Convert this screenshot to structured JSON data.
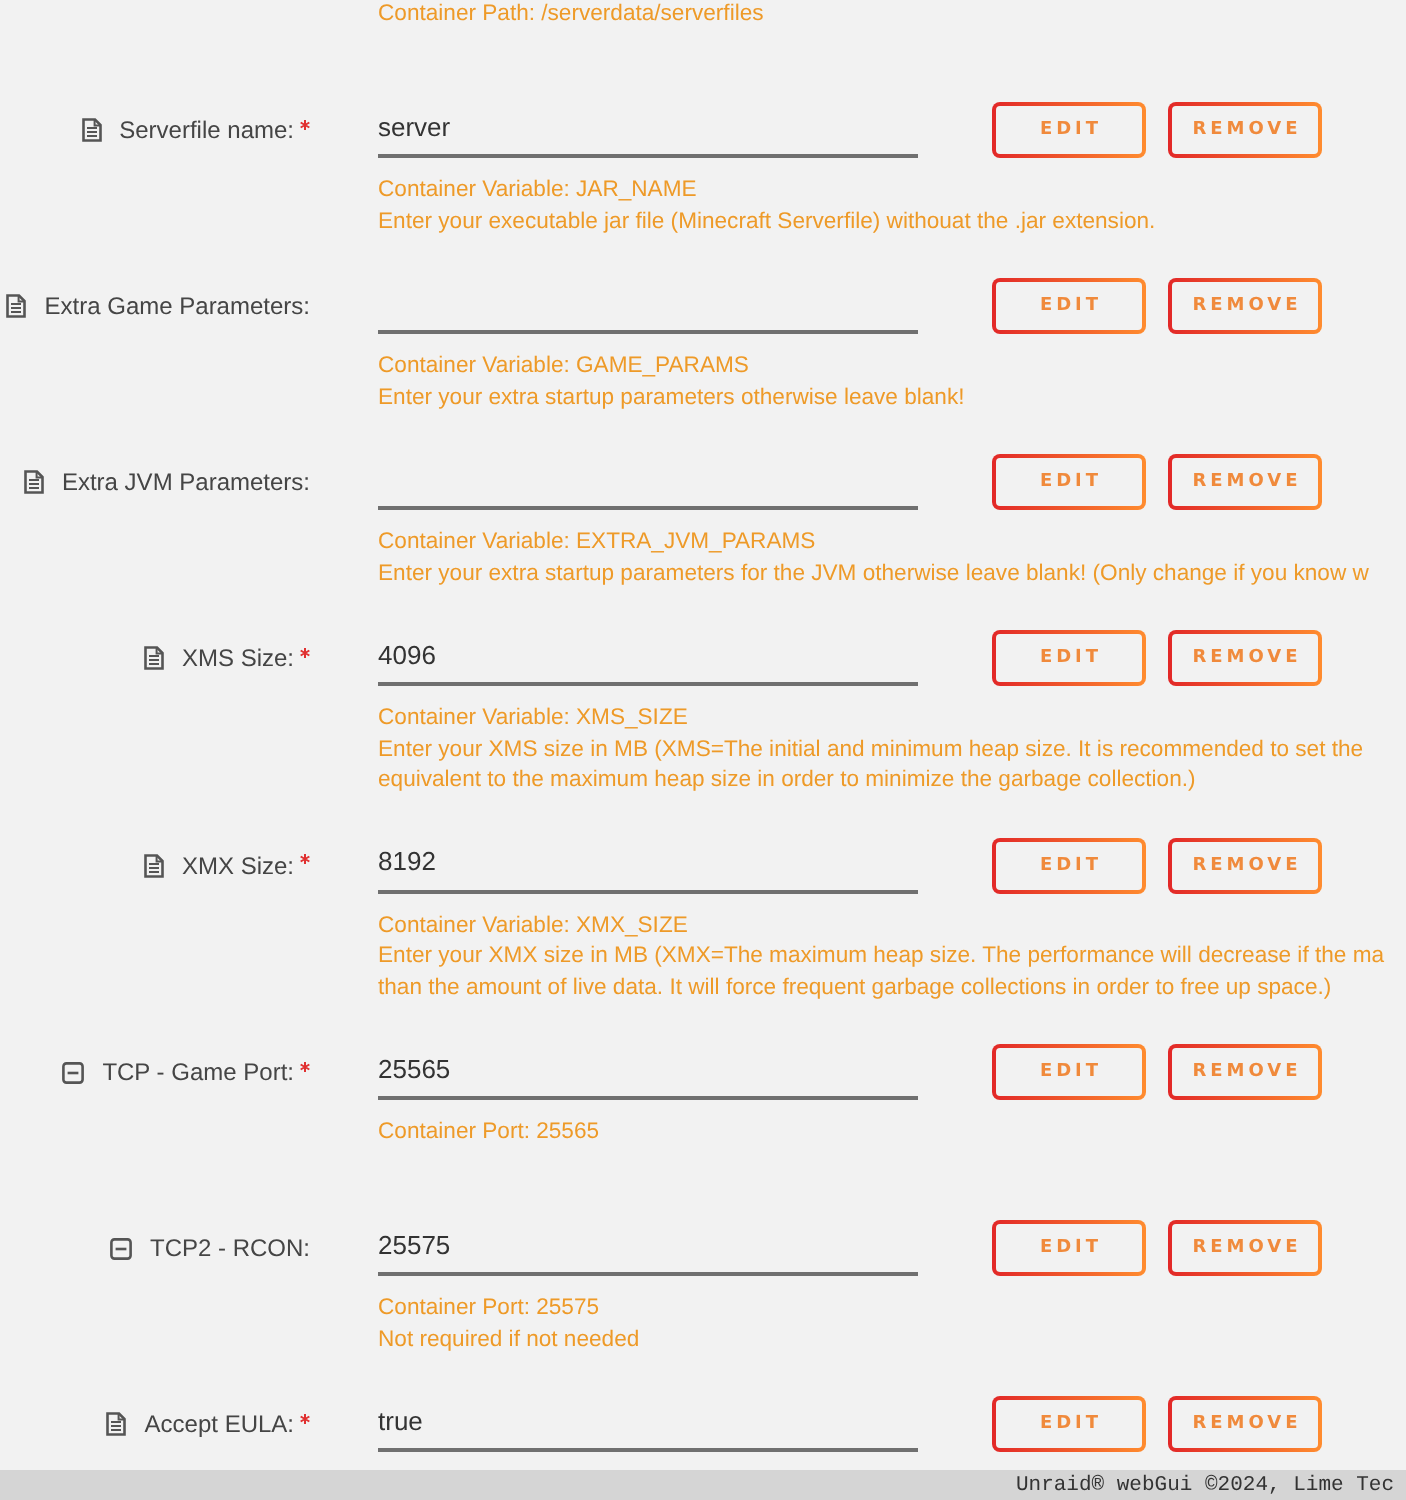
{
  "top_hints": [
    "Container Path: /serverdata/serverfiles"
  ],
  "settings": [
    {
      "kind": "variable",
      "label": "Serverfile name:",
      "required": true,
      "value": "server",
      "hints": [
        "Container Variable: JAR_NAME",
        "Enter your executable jar file (Minecraft Serverfile) withouat the .jar extension."
      ],
      "buttons": [
        "EDIT",
        "REMOVE"
      ]
    },
    {
      "kind": "variable",
      "label": "Extra Game Parameters:",
      "required": false,
      "hints": [
        "Container Variable: GAME_PARAMS",
        "Enter your extra startup parameters otherwise leave blank!"
      ],
      "buttons": [
        "EDIT",
        "REMOVE"
      ]
    },
    {
      "kind": "variable",
      "label": "Extra JVM Parameters:",
      "required": false,
      "hints": [
        "Container Variable: EXTRA_JVM_PARAMS",
        "Enter your extra startup parameters for the JVM otherwise leave blank! (Only change if you know w"
      ],
      "buttons": [
        "EDIT",
        "REMOVE"
      ]
    },
    {
      "kind": "variable",
      "label": "XMS Size:",
      "required": true,
      "value": "4096",
      "hints": [
        "Container Variable: XMS_SIZE",
        "Enter your XMS size in MB (XMS=The initial and minimum heap size. It is recommended to set the",
        "equivalent to the maximum heap size in order to minimize the garbage collection.)"
      ],
      "buttons": [
        "EDIT",
        "REMOVE"
      ]
    },
    {
      "kind": "variable",
      "label": "XMX Size:",
      "required": true,
      "value": "8192",
      "hints": [
        "Container Variable: XMX_SIZE",
        "Enter your XMX size in MB (XMX=The maximum heap size. The performance will decrease if the ma",
        "than the amount of live data. It will force frequent garbage collections in order to free up space.)"
      ],
      "buttons": [
        "EDIT",
        "REMOVE"
      ]
    },
    {
      "kind": "port",
      "label": "TCP - Game Port:",
      "required": true,
      "value": "25565",
      "hints": [
        "Container Port: 25565"
      ],
      "buttons": [
        "EDIT",
        "REMOVE"
      ]
    },
    {
      "kind": "port",
      "label": "TCP2 - RCON:",
      "required": false,
      "value": "25575",
      "hints": [
        "Container Port: 25575",
        "Not required if not needed"
      ],
      "buttons": [
        "EDIT",
        "REMOVE"
      ]
    },
    {
      "kind": "variable",
      "label": "Accept EULA:",
      "required": true,
      "value": "true",
      "buttons": [
        "EDIT",
        "REMOVE"
      ]
    }
  ],
  "footer": {
    "text": "Unraid® webGui ©2024, Lime Tec"
  }
}
